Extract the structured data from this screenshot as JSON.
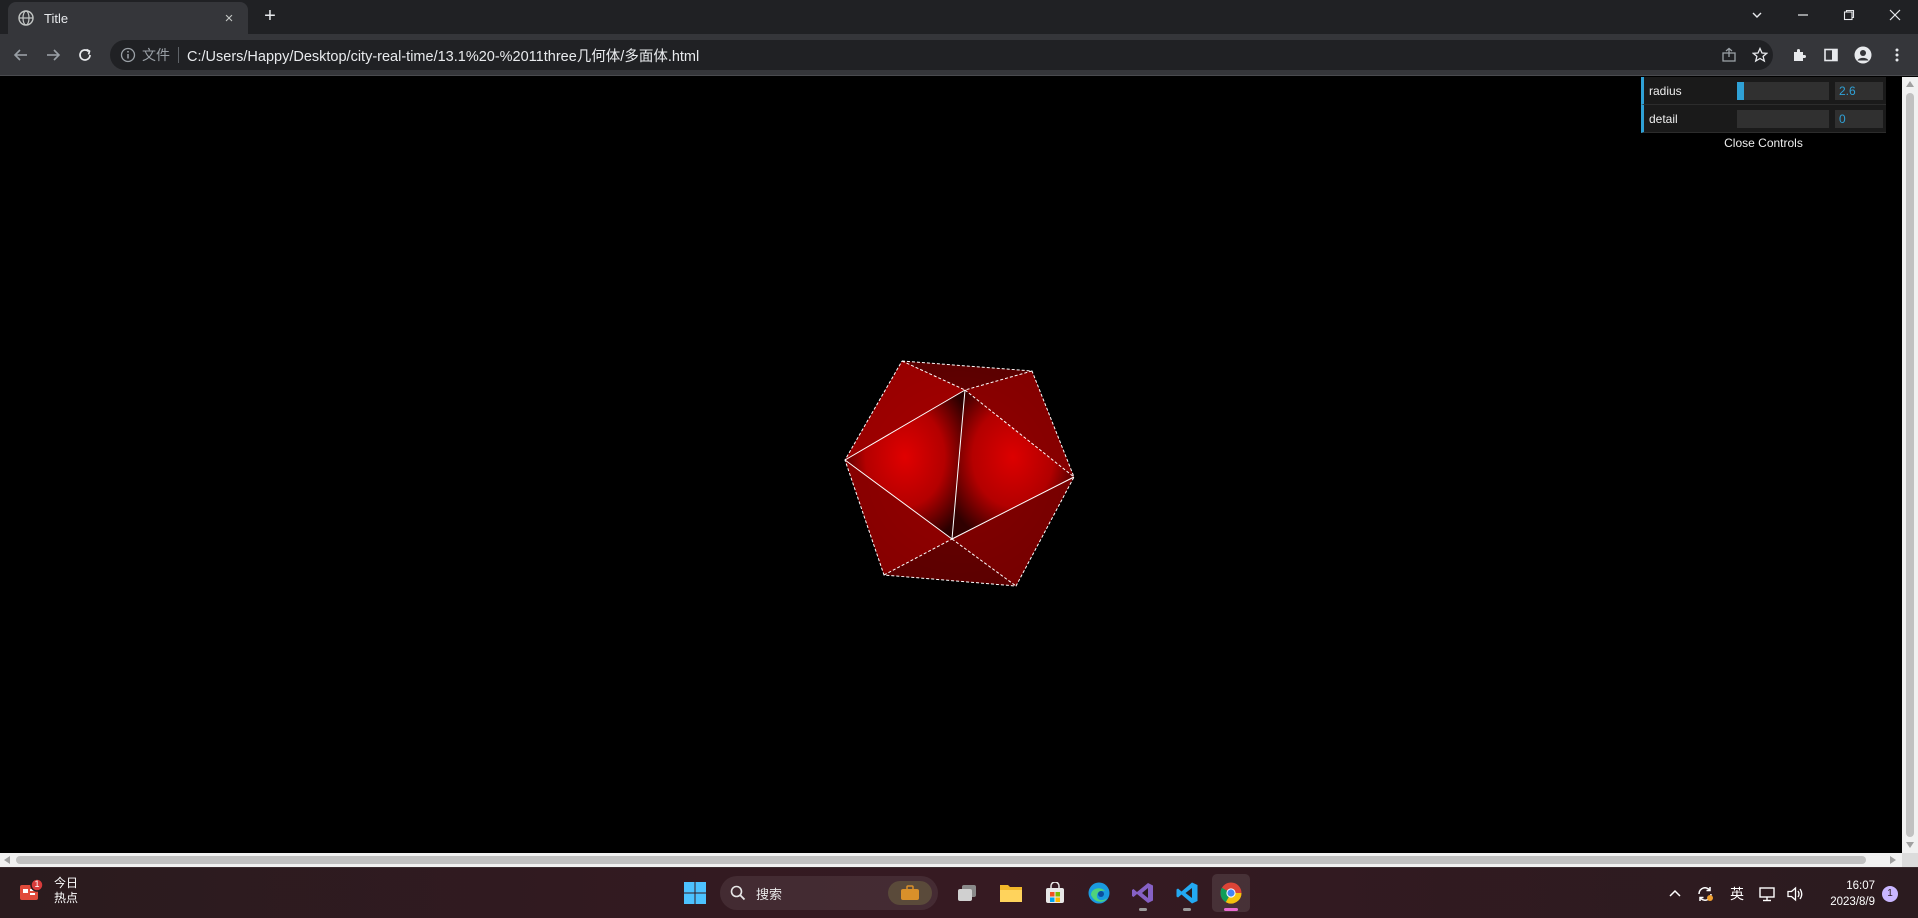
{
  "browser": {
    "tab_title": "Title",
    "tab_close": "×",
    "new_tab": "+",
    "scheme_label": "文件",
    "url": "C:/Users/Happy/Desktop/city-real-time/13.1%20-%2011three几何体/多面体.html"
  },
  "gui": {
    "controls": [
      {
        "label": "radius",
        "value": "2.6",
        "fraction": 0.08
      },
      {
        "label": "detail",
        "value": "0",
        "fraction": 0.0
      }
    ],
    "close_label": "Close Controls"
  },
  "scene": {
    "object": "icosahedron",
    "fill_color": "#cc0000",
    "edge_color": "#ffffff"
  },
  "taskbar": {
    "widget_line1": "今日",
    "widget_line2": "热点",
    "widget_badge": "1",
    "search_label": "搜索",
    "tray_lang": "英",
    "clock_time": "16:07",
    "clock_date": "2023/8/9",
    "notification_count": "1"
  }
}
